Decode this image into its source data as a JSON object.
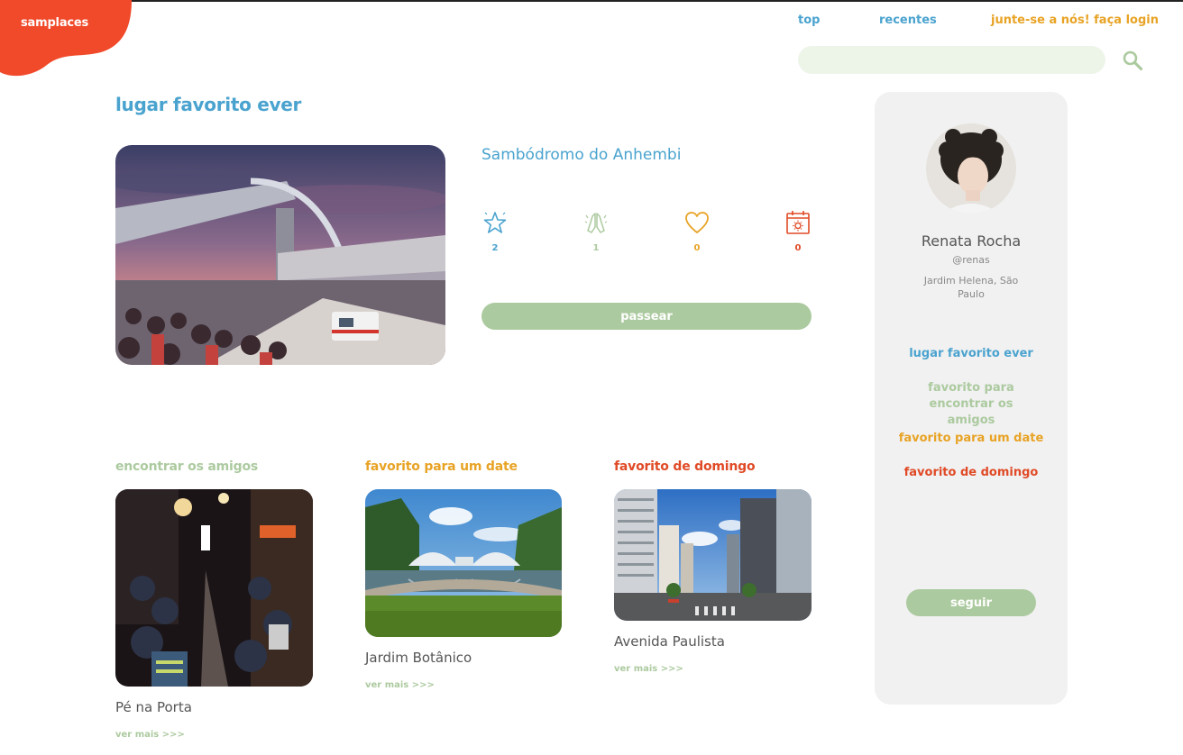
{
  "brand": {
    "logo_text": "samplaces",
    "color": "#f04a2a"
  },
  "nav": {
    "top": "top",
    "recentes": "recentes",
    "join": "junte-se a nós! faça login"
  },
  "search": {
    "placeholder": "",
    "icon": "search-icon"
  },
  "colors": {
    "blue": "#4aa3cf",
    "green": "#acca9f",
    "orange": "#e8a325",
    "red": "#e04a26",
    "panel": "#f1f1f1"
  },
  "favorite": {
    "section_title": "lugar favorito ever",
    "place_name": "Sambódromo do Anhembi",
    "stats": [
      {
        "icon": "star-icon",
        "value": "2"
      },
      {
        "icon": "praying-hands-icon",
        "value": "1"
      },
      {
        "icon": "heart-icon",
        "value": "0"
      },
      {
        "icon": "calendar-sun-icon",
        "value": "0"
      }
    ],
    "button": "passear"
  },
  "categories": [
    {
      "title": "encontrar os amigos",
      "place": "Pé na Porta",
      "link": "ver mais >>>"
    },
    {
      "title": "favorito para um date",
      "place": "Jardim Botânico",
      "link": "ver mais >>>"
    },
    {
      "title": "favorito de domingo",
      "place": "Avenida Paulista",
      "link": "ver mais >>>"
    }
  ],
  "profile": {
    "name": "Renata Rocha",
    "handle": "@renas",
    "location": "Jardim Helena, São Paulo",
    "links": [
      "lugar favorito ever",
      "favorito para encontrar os amigos",
      "favorito para um date",
      "favorito de domingo"
    ],
    "follow_button": "seguir"
  }
}
